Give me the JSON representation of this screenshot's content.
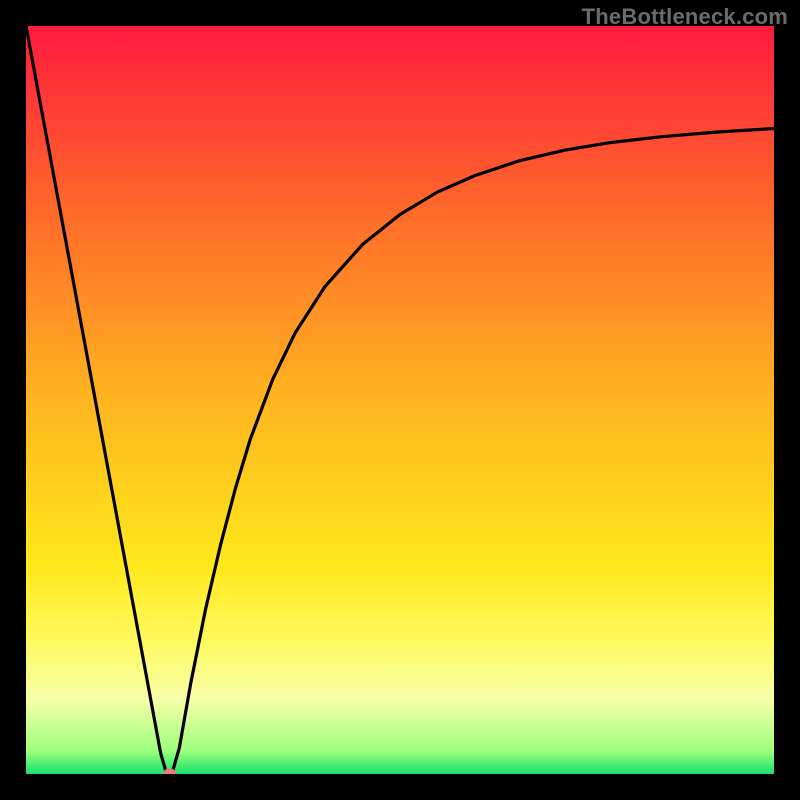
{
  "watermark": "TheBottleneck.com",
  "chart_data": {
    "type": "line",
    "title": "",
    "xlabel": "",
    "ylabel": "",
    "xlim": [
      0,
      100
    ],
    "ylim": [
      0,
      100
    ],
    "grid": false,
    "gradient_stops": [
      {
        "pos": 0.0,
        "color": "#ff1a3e"
      },
      {
        "pos": 0.25,
        "color": "#ff6a2a"
      },
      {
        "pos": 0.5,
        "color": "#ffb520"
      },
      {
        "pos": 0.72,
        "color": "#ffe81a"
      },
      {
        "pos": 0.82,
        "color": "#fff95d"
      },
      {
        "pos": 0.9,
        "color": "#f7ffa8"
      },
      {
        "pos": 0.97,
        "color": "#9aff7c"
      },
      {
        "pos": 1.0,
        "color": "#15e06e"
      }
    ],
    "series": [
      {
        "name": "curve",
        "stroke": "#000000",
        "x": [
          0,
          2,
          4,
          6,
          8,
          10,
          12,
          14,
          16,
          18,
          18.8,
          19.5,
          20.5,
          22,
          24,
          26,
          28,
          30,
          33,
          36,
          40,
          45,
          50,
          55,
          60,
          66,
          72,
          78,
          85,
          92,
          100
        ],
        "values": [
          100,
          89.2,
          78.4,
          67.6,
          56.8,
          46.0,
          35.2,
          24.4,
          13.6,
          2.8,
          0.0,
          0.0,
          3.5,
          12.0,
          22.0,
          30.6,
          38.2,
          44.8,
          52.8,
          59.0,
          65.2,
          70.8,
          74.8,
          77.8,
          80.0,
          82.0,
          83.4,
          84.4,
          85.2,
          85.8,
          86.3
        ]
      }
    ],
    "marker": {
      "x": 19.2,
      "y": 0.0,
      "color": "#e97d7d",
      "radius": 7
    }
  }
}
